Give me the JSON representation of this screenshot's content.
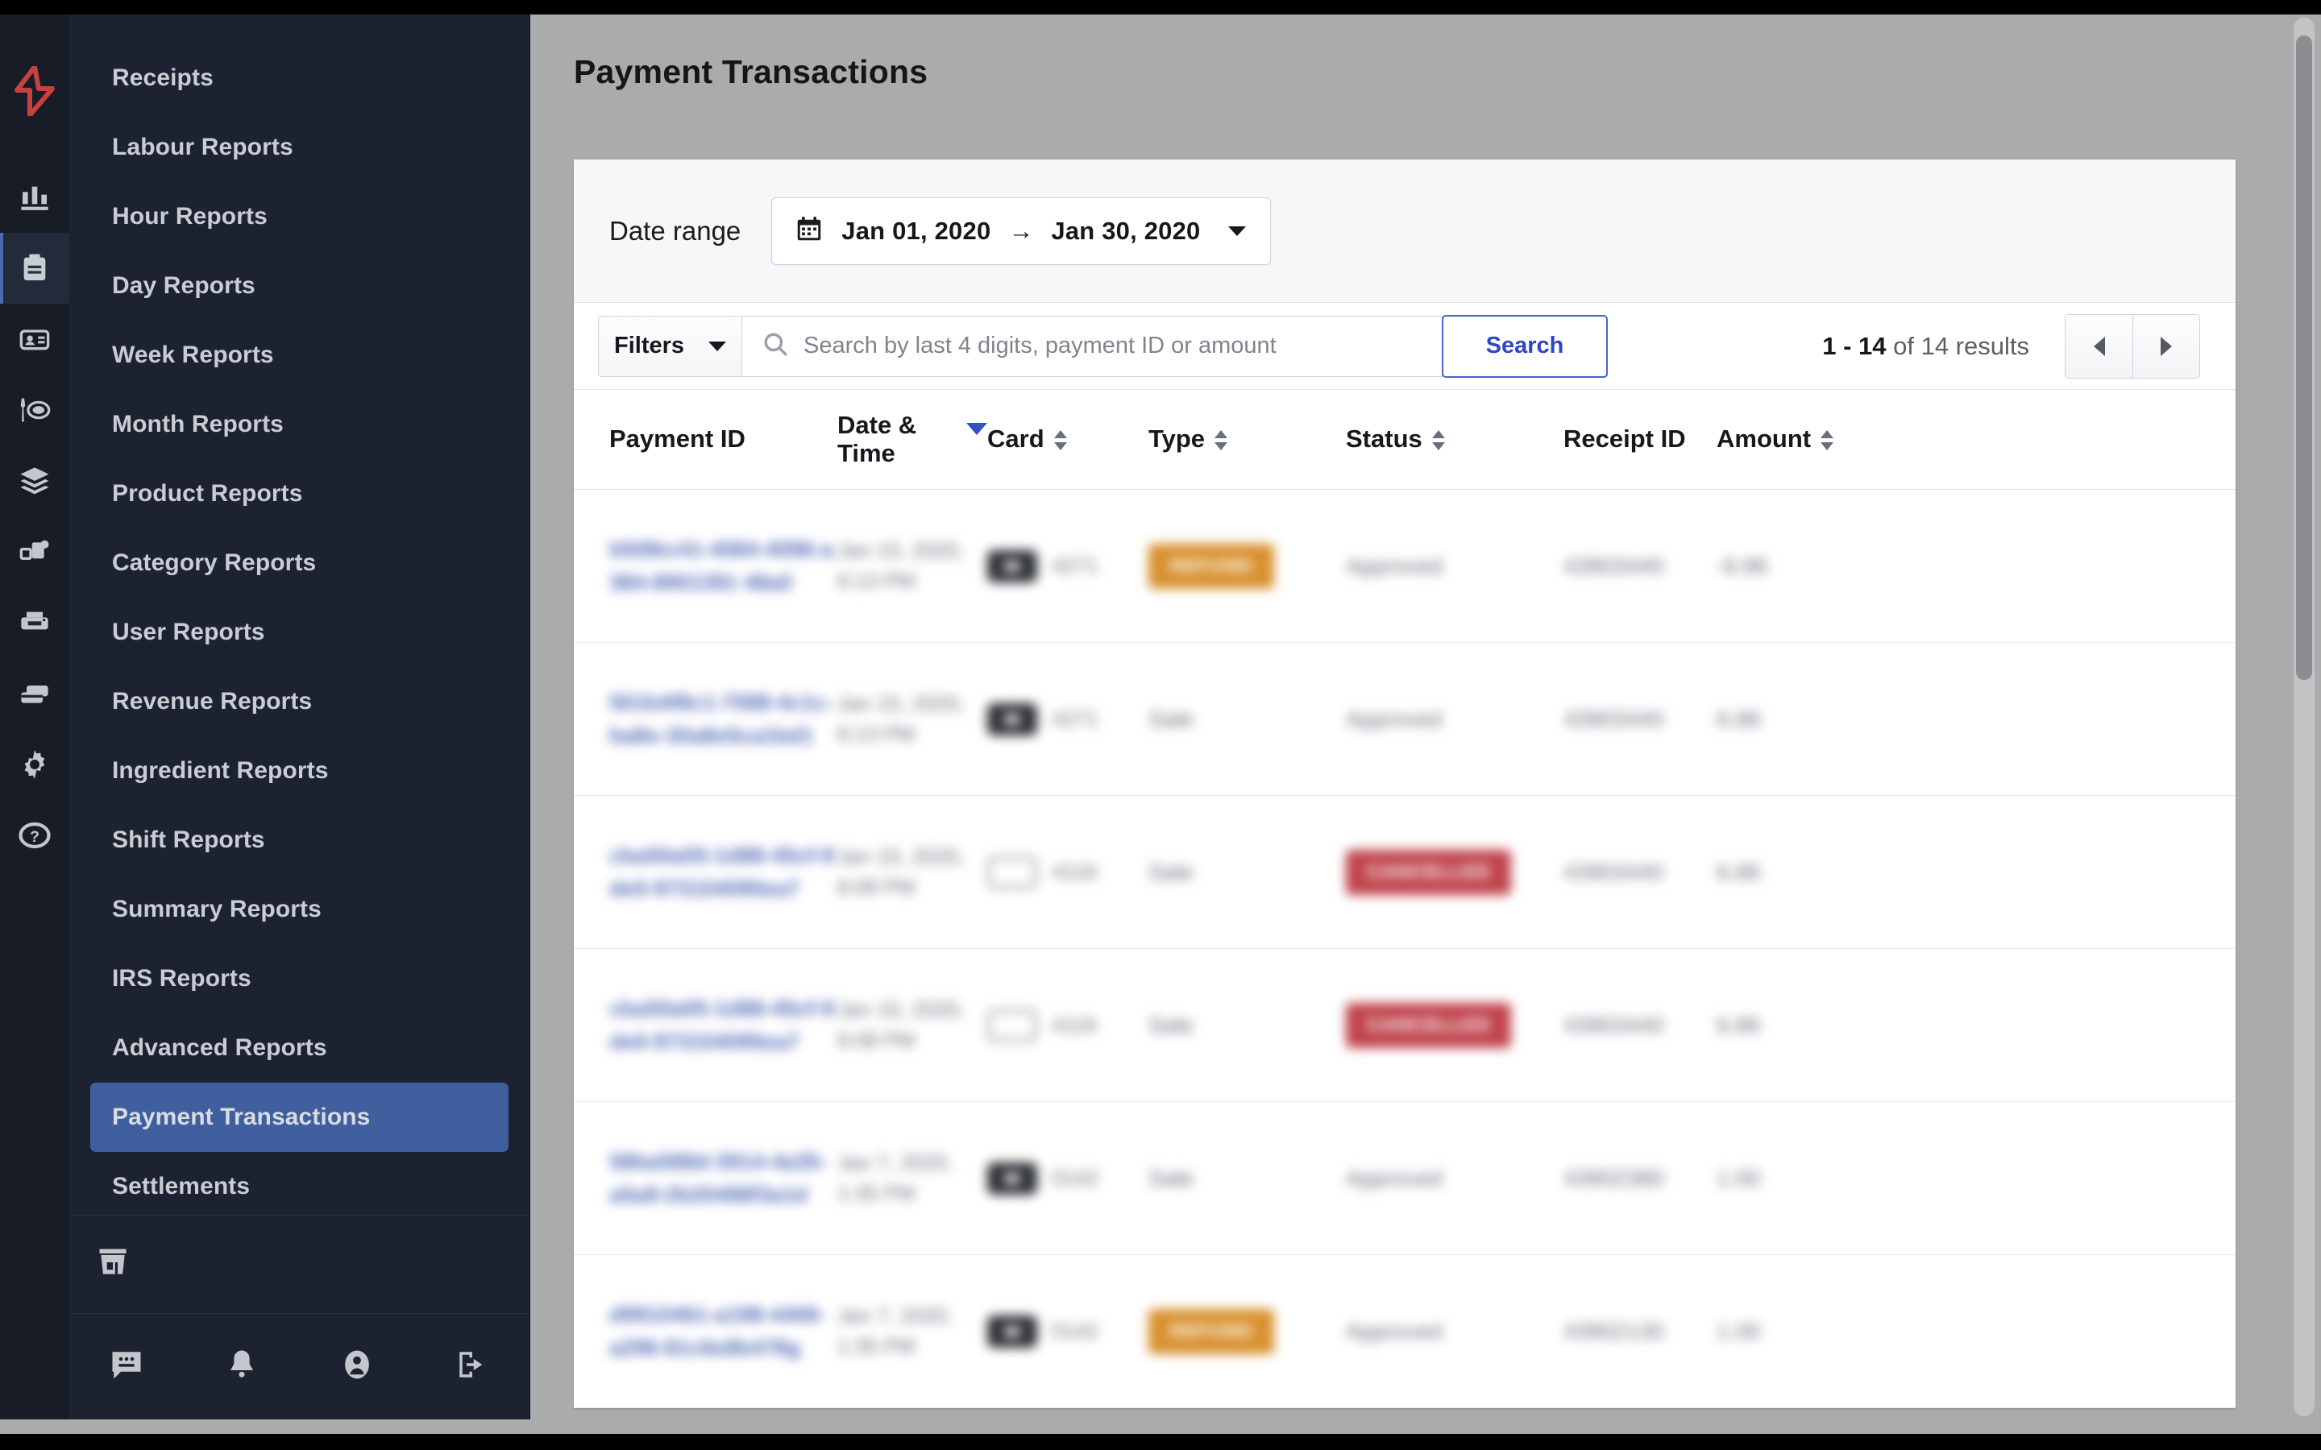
{
  "app": {
    "brand_icon": "lightspeed-flame-logo",
    "accent_blue": "#3f5f9e",
    "link_blue": "#5068b4",
    "sidebar_bg": "#1c2230",
    "rail_bg": "#171c27"
  },
  "rail": {
    "items": [
      {
        "icon": "bar-chart-icon",
        "name": "dashboard",
        "active": false
      },
      {
        "icon": "clipboard-icon",
        "name": "reports",
        "active": true
      },
      {
        "icon": "id-card-icon",
        "name": "customers",
        "active": false
      },
      {
        "icon": "dining-icon",
        "name": "menu",
        "active": false
      },
      {
        "icon": "layers-icon",
        "name": "inventory",
        "active": false
      },
      {
        "icon": "devices-icon",
        "name": "devices",
        "active": false
      },
      {
        "icon": "printer-icon",
        "name": "printers",
        "active": false
      },
      {
        "icon": "payments-icon",
        "name": "payments",
        "active": false
      },
      {
        "icon": "gear-icon",
        "name": "settings",
        "active": false
      },
      {
        "icon": "help-circle-icon",
        "name": "help",
        "active": false
      }
    ]
  },
  "sidebar": {
    "items": [
      {
        "label": "Receipts",
        "active": false
      },
      {
        "label": "Labour Reports",
        "active": false
      },
      {
        "label": "Hour Reports",
        "active": false
      },
      {
        "label": "Day Reports",
        "active": false
      },
      {
        "label": "Week Reports",
        "active": false
      },
      {
        "label": "Month Reports",
        "active": false
      },
      {
        "label": "Product Reports",
        "active": false
      },
      {
        "label": "Category Reports",
        "active": false
      },
      {
        "label": "User Reports",
        "active": false
      },
      {
        "label": "Revenue Reports",
        "active": false
      },
      {
        "label": "Ingredient Reports",
        "active": false
      },
      {
        "label": "Shift Reports",
        "active": false
      },
      {
        "label": "Summary Reports",
        "active": false
      },
      {
        "label": "IRS Reports",
        "active": false
      },
      {
        "label": "Advanced Reports",
        "active": false
      },
      {
        "label": "Payment Transactions",
        "active": true
      },
      {
        "label": "Settlements",
        "active": false
      }
    ],
    "footer_top_icon": "store-icon",
    "footer_icons": [
      {
        "icon": "chat-icon",
        "name": "messages"
      },
      {
        "icon": "bell-icon",
        "name": "notifications"
      },
      {
        "icon": "account-icon",
        "name": "account"
      },
      {
        "icon": "logout-icon",
        "name": "logout"
      }
    ]
  },
  "header": {
    "title": "Payment Transactions"
  },
  "date_range": {
    "label": "Date range",
    "calendar_icon": "calendar-icon",
    "start": "Jan 01, 2020",
    "arrow": "→",
    "end": "Jan 30, 2020",
    "caret_icon": "chevron-down-icon"
  },
  "toolbar": {
    "filters_label": "Filters",
    "filters_caret_icon": "chevron-down-icon",
    "search_icon": "search-icon",
    "search_placeholder": "Search by last 4 digits, payment ID or amount",
    "search_value": "",
    "search_button_label": "Search",
    "results_range": "1 - 14",
    "results_suffix": "of 14 results",
    "prev_icon": "chevron-left-icon",
    "next_icon": "chevron-right-icon"
  },
  "table": {
    "columns": [
      {
        "label": "Payment ID",
        "sortable": false,
        "sort": "none"
      },
      {
        "label": "Date & Time",
        "sortable": true,
        "sort": "desc"
      },
      {
        "label": "Card",
        "sortable": true,
        "sort": "none"
      },
      {
        "label": "Type",
        "sortable": true,
        "sort": "none"
      },
      {
        "label": "Status",
        "sortable": true,
        "sort": "none"
      },
      {
        "label": "Receipt ID",
        "sortable": false,
        "sort": "none"
      },
      {
        "label": "Amount",
        "sortable": true,
        "sort": "none"
      }
    ],
    "redacted": true,
    "rows": [
      {
        "payment_id": "b5t9kc41-4084-4096-a384-8901391 48a0",
        "datetime": "Jan 15, 2020, 6:13 PM",
        "card_style": "filled",
        "card_digits": "4271",
        "type": "REFUND",
        "type_style": "refund",
        "status": "Approved",
        "receipt_id": "43903440",
        "amount": "-6.86"
      },
      {
        "payment_id": "501b4f8c1-7088-4c1c-ba8e-30a8e5ca1bd1",
        "datetime": "Jan 15, 2020, 6:13 PM",
        "card_style": "filled",
        "card_digits": "4271",
        "type": "Sale",
        "type_style": "plain",
        "status": "Approved",
        "receipt_id": "43903440",
        "amount": "6.86"
      },
      {
        "payment_id": "cba50a05-1d88-45cf-9de0-973104095ea7",
        "datetime": "Jan 15, 2020, 6:08 PM",
        "card_style": "outline",
        "card_digits": "4116",
        "type": "Sale",
        "type_style": "plain",
        "status": "CANCELLED",
        "status_style": "cancelled",
        "receipt_id": "43903440",
        "amount": "6.86"
      },
      {
        "payment_id": "cba50a05-1d88-45cf-9de0-973104095ea7",
        "datetime": "Jan 15, 2020, 6:08 PM",
        "card_style": "outline",
        "card_digits": "4116",
        "type": "Sale",
        "type_style": "plain",
        "status": "CANCELLED",
        "status_style": "cancelled",
        "receipt_id": "43903440",
        "amount": "6.86"
      },
      {
        "payment_id": "58ba588d-3914-4a35-a5a9-2b20498f3a1d",
        "datetime": "Jan 7, 2020, 1:35 PM",
        "card_style": "filled",
        "card_digits": "0142",
        "type": "Sale",
        "type_style": "plain",
        "status": "Approved",
        "receipt_id": "43902380",
        "amount": "1.00"
      },
      {
        "payment_id": "d9910461-a198-4406-a296-81c6e8b478g",
        "datetime": "Jan 7, 2020, 1:35 PM",
        "card_style": "filled",
        "card_digits": "0142",
        "type": "REFUND",
        "type_style": "refund",
        "status": "Approved",
        "receipt_id": "43902130",
        "amount": "1.00"
      }
    ]
  }
}
